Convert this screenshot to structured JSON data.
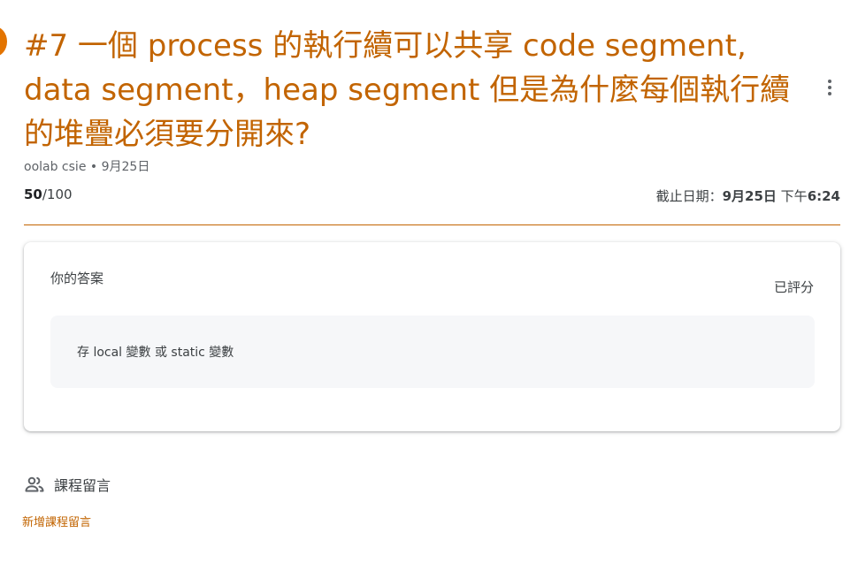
{
  "assignment": {
    "title": "#7 一個 process 的執行續可以共享 code segment, data segment，heap segment 但是為什麼每個執行續的堆疊必須要分開來?",
    "author": "oolab csie",
    "separator": " • ",
    "posted_date": "9月25日",
    "points_earned": "50",
    "points_total": "/100",
    "due_label": "截止日期：",
    "due_date": "9月25日",
    "due_time_prefix": " 下午",
    "due_time": "6:24"
  },
  "your_work": {
    "title": "你的答案",
    "status": "已評分",
    "answer": "存 local 變數 或 static 變數"
  },
  "comments": {
    "title": "課程留言",
    "add_label": "新增課程留言"
  },
  "icons": {
    "menu": "more-vert-icon",
    "people": "people-icon"
  },
  "colors": {
    "accent": "#c26401",
    "badge": "#e37400",
    "answer_bg": "#f6f7f9"
  }
}
